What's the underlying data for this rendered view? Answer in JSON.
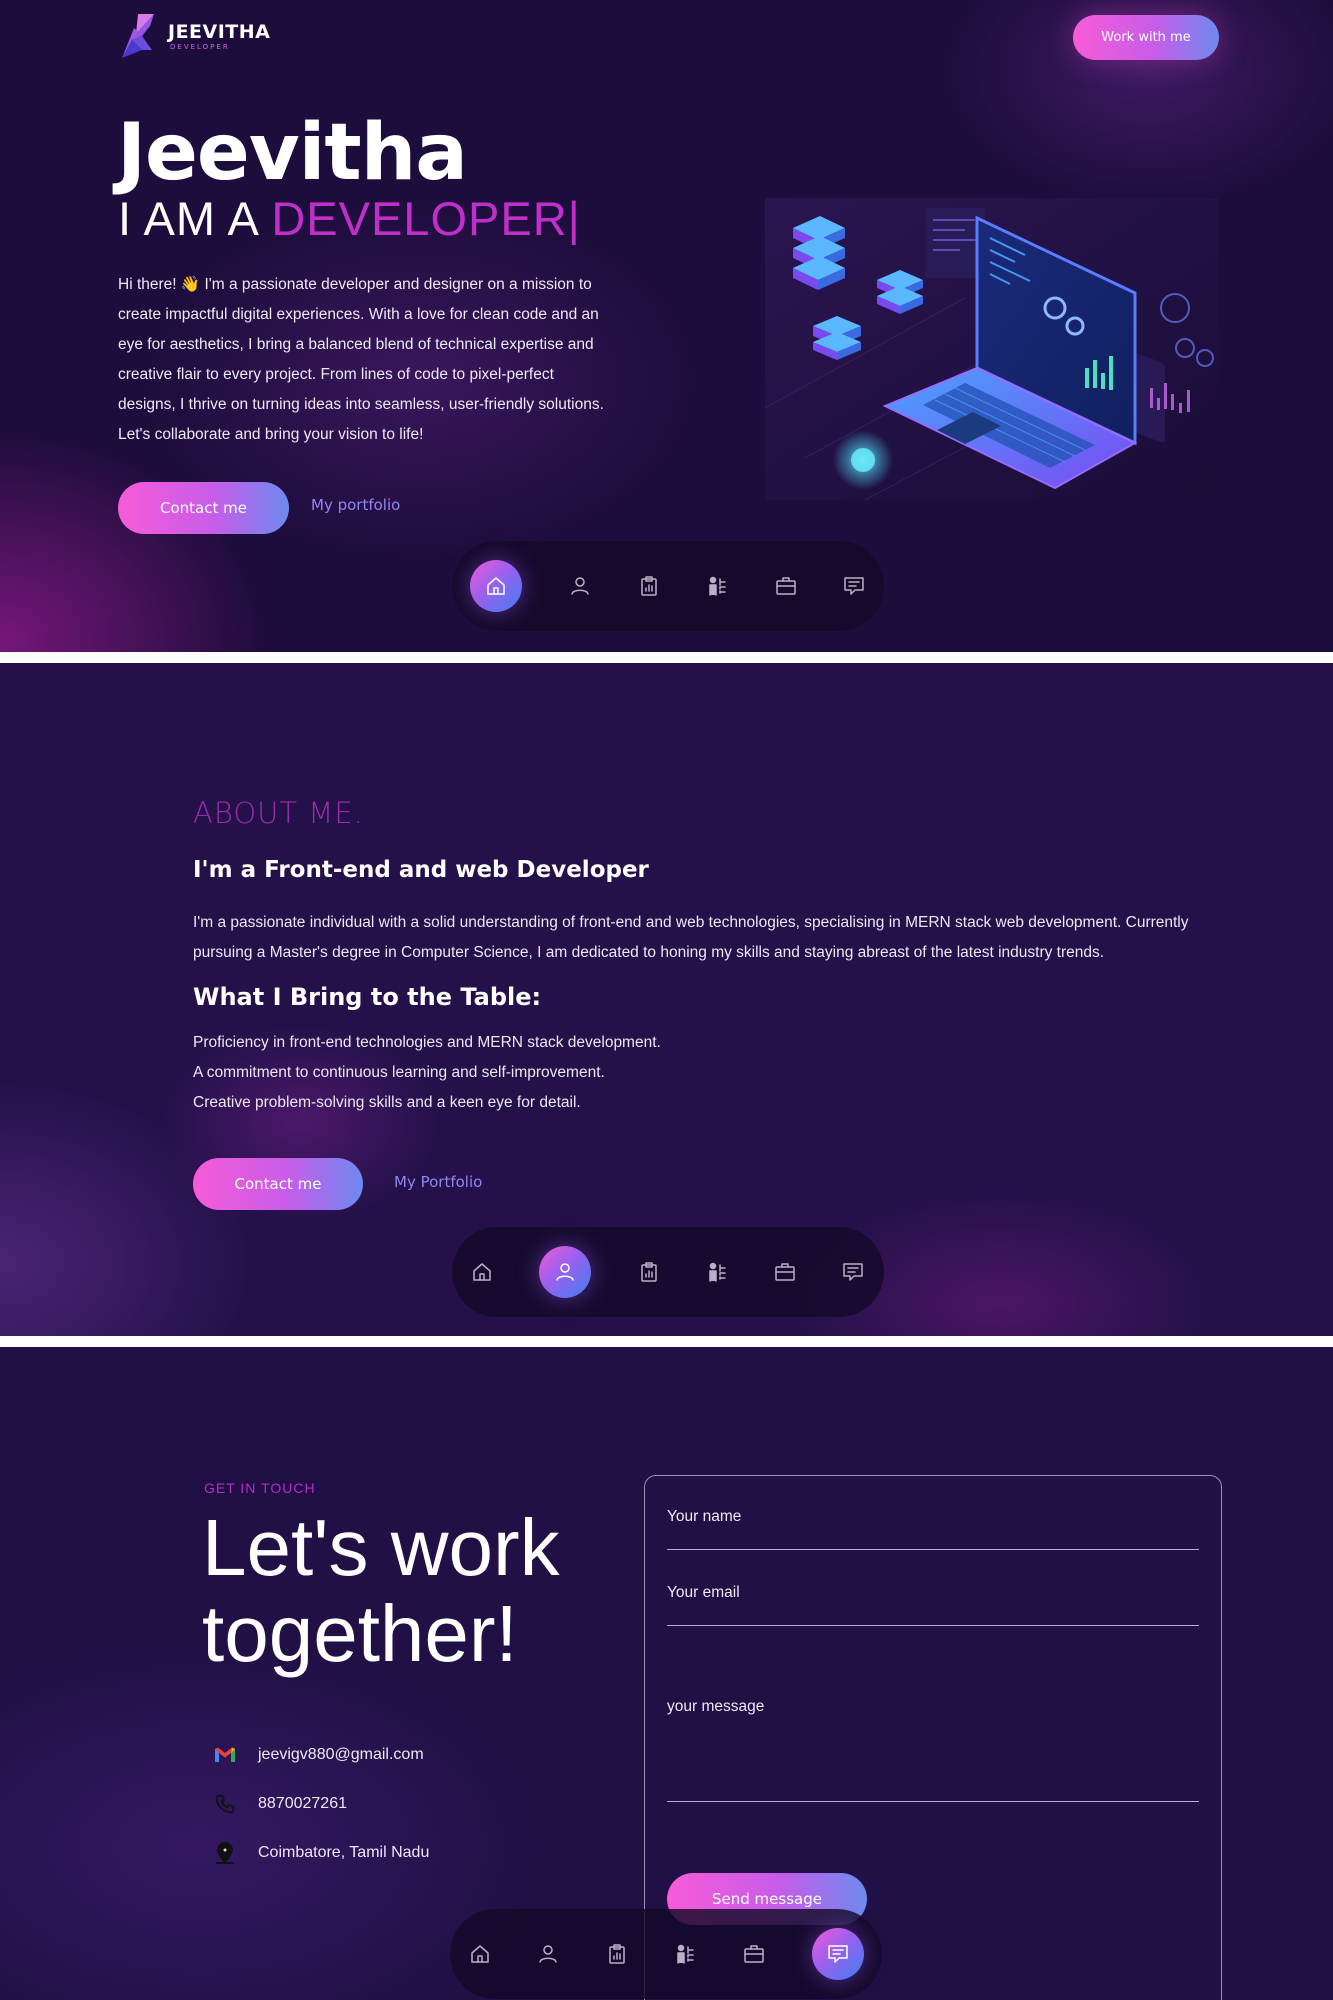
{
  "header": {
    "logo_name": "JEEVITHA",
    "logo_sub": "DEVELOPER",
    "work_button": "Work with me"
  },
  "hero": {
    "name": "Jeevitha",
    "role_prefix": "I AM A ",
    "role_accent": "DEVELOPER",
    "role_caret": "|",
    "description": "Hi there! 👋 I'm a passionate developer and designer on a mission to create impactful digital experiences. With a love for clean code and an eye for aesthetics, I bring a balanced blend of technical expertise and creative flair to every project. From lines of code to pixel-perfect designs, I thrive on turning ideas into seamless, user-friendly solutions. Let's collaborate and bring your vision to life!",
    "contact_button": "Contact me",
    "portfolio_link": "My portfolio"
  },
  "about": {
    "label": "ABOUT ME.",
    "heading": "I'm a Front-end and web Developer",
    "paragraph": "I'm a passionate individual with a solid understanding of front-end and web technologies, specialising in MERN stack web development. Currently pursuing a Master's degree in Computer Science, I am dedicated to honing my skills and staying abreast of the latest industry trends.",
    "subheading": "What I Bring to the Table:",
    "points": [
      "Proficiency in front-end technologies and MERN stack development.",
      "A commitment to continuous learning and self-improvement.",
      "Creative problem-solving skills and a keen eye for detail."
    ],
    "contact_button": "Contact me",
    "portfolio_link": "My Portfolio"
  },
  "contact": {
    "eyebrow": "GET IN TOUCH",
    "title_line1": "Let's work",
    "title_line2": "together!",
    "email": "jeevigv880@gmail.com",
    "phone": "8870027261",
    "location": "Coimbatore, Tamil Nadu",
    "form": {
      "name_placeholder": "Your name",
      "email_placeholder": "Your email",
      "message_placeholder": "your message",
      "send_button": "Send message"
    }
  },
  "nav_dock": {
    "icons": [
      "home-icon",
      "user-icon",
      "clipboard-chart-icon",
      "skills-icon",
      "briefcase-icon",
      "message-icon"
    ],
    "active_hero": "home-icon",
    "active_about": "user-icon",
    "active_contact": "message-icon"
  },
  "colors": {
    "background": "#1d0d3c",
    "accent_magenta": "#c02fc9",
    "gradient_start": "#f75bd8",
    "gradient_end": "#6d8af0",
    "link": "#8f86f5"
  }
}
